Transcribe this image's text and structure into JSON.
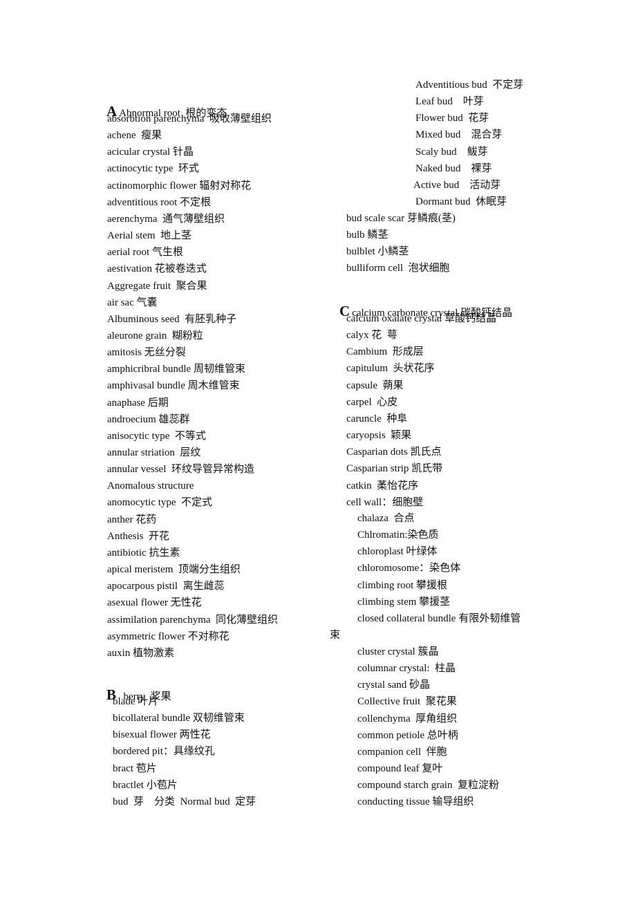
{
  "sections": {
    "A": {
      "letter": "A",
      "header": "Abnormal root  根的变态",
      "entries": [
        "absorbtion parenchyma  吸收薄壁组织",
        "achene  瘦果",
        "acicular crystal 针晶",
        "actinocytic type  环式",
        "actinomorphic flower 辐射对称花",
        "adventitious root 不定根",
        "aerenchyma  通气薄壁组织",
        "Aerial stem  地上茎",
        "aerial root 气生根",
        "aestivation 花被卷迭式",
        "Aggregate fruit  聚合果",
        "air sac 气囊",
        "Albuminous seed  有胚乳种子",
        "aleurone grain  糊粉粒",
        "amitosis 无丝分裂",
        "amphicribral bundle 周韧维管束",
        "amphivasal bundle 周木维管束",
        "anaphase 后期",
        "androecium 雄蕊群",
        "anisocytic type  不等式",
        "annular striation  层纹",
        "annular vessel  环纹导管异常构造",
        "Anomalous structure",
        "anomocytic type  不定式",
        "anther 花药",
        "Anthesis  开花",
        "antibiotic 抗生素",
        "apical meristem  顶端分生组织",
        "apocarpous pistil  离生雌蕊",
        "asexual flower 无性花",
        "assimilation parenchyma  同化薄壁组织",
        "asymmetric flower 不对称花",
        "auxin 植物激素"
      ]
    },
    "B": {
      "letter": "B",
      "header": "  berry  浆果",
      "entries": [
        "blade 叶片",
        "bicollateral bundle 双韧维管束",
        "bisexual flower 两性花",
        "bordered pit：具缘纹孔",
        "bract 苞片",
        "bractlet 小苞片",
        "bud  芽    分类  Normal bud  定芽"
      ],
      "bud_types": [
        "Adventitious bud  不定芽",
        "Leaf bud    叶芽",
        "Flower bud  花芽",
        "Mixed bud    混合芽",
        "Scaly bud    鲅芽",
        "Naked bud    裸芽",
        "Active bud    活动芽",
        "Dormant bud  休眠芽"
      ],
      "entries_cont": [
        "bud scale scar 芽鳞痕(茎)",
        "bulb 鳞茎",
        "bulblet 小鳞茎",
        "bulliform cell  泡状细胞"
      ]
    },
    "C": {
      "letter": "C",
      "header": "calcium carbonate crystal 碳酸钙结晶",
      "entries": [
        "calcium oxalate crystal 草酸钙结晶",
        "calyx 花  萼",
        "Cambium  形成层",
        "capitulum  头状花序",
        "capsule  蒴果",
        "carpel  心皮",
        "caruncle  种阜",
        "caryopsis  颖果",
        "Casparian dots 凯氏点",
        "Casparian strip 凯氏带",
        "catkin  葇怡花序",
        "cell wall：细胞壁"
      ],
      "entries_indented": [
        "chalaza  合点",
        "Chlromatin:染色质",
        "chloroplast 叶绿体",
        "chloromosome：染色体",
        "climbing root 攀援根",
        "climbing stem 攀援茎",
        "closed collateral bundle 有限外韧维管"
      ],
      "wrap_char": "束",
      "entries_indented2": [
        "cluster crystal 簇晶",
        "columnar crystal:  柱晶",
        "crystal sand 砂晶",
        "Collective fruit  聚花果",
        "collenchyma  厚角组织",
        "common petiole 总叶柄",
        "companion cell  伴胞",
        "compound leaf 复叶",
        "compound starch grain  复粒淀粉",
        "conducting tissue 输导组织"
      ]
    }
  }
}
